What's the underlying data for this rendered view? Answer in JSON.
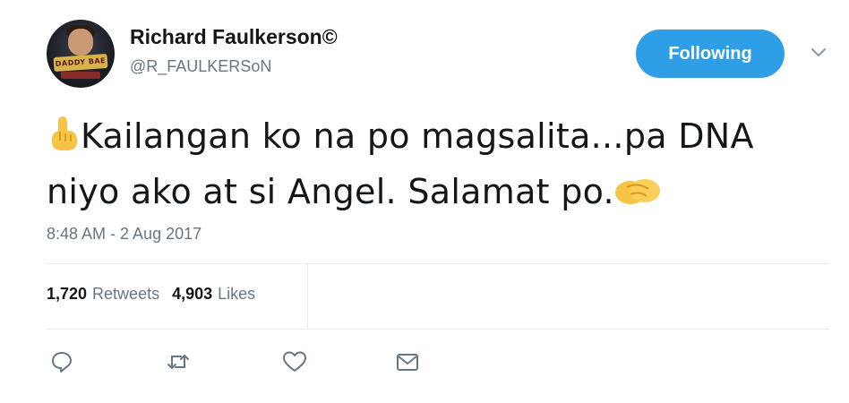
{
  "user": {
    "display_name": "Richard Faulkerson©",
    "handle": "@R_FAULKERSoN",
    "avatar_banner_text": "DADDY BAE"
  },
  "follow_button": {
    "label": "Following",
    "color": "#2e9fe6"
  },
  "tweet": {
    "emoji_start": "point-up-emoji",
    "line1": "Kailangan ko na po magsalita...pa DNA",
    "line2": "niyo ako at si Angel. Salamat po.",
    "emoji_end": "handshake-emoji",
    "timestamp": "8:48 AM - 2 Aug 2017"
  },
  "stats": {
    "retweets_count": "1,720",
    "retweets_label": "Retweets",
    "likes_count": "4,903",
    "likes_label": "Likes"
  },
  "actions": [
    "reply-icon",
    "retweet-icon",
    "like-icon",
    "message-icon"
  ]
}
